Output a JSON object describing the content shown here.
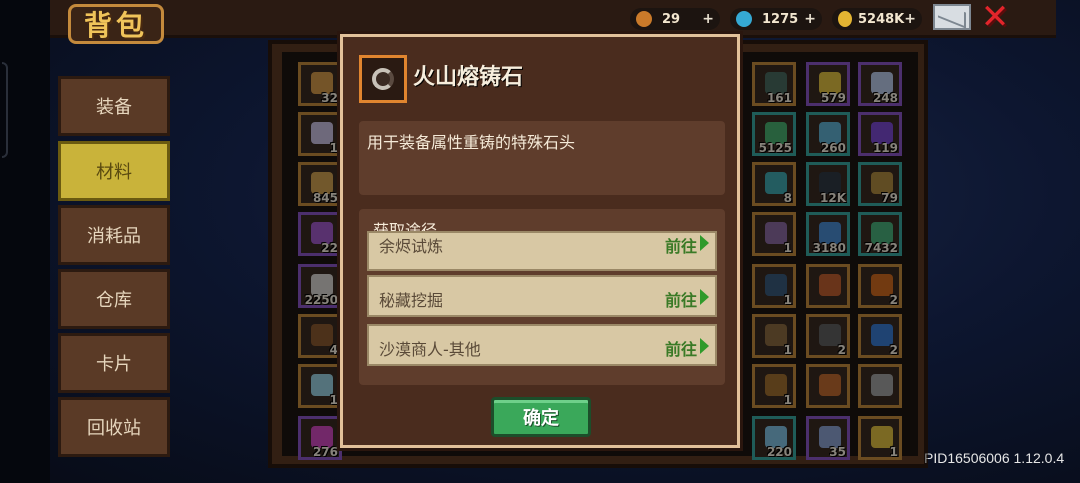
{
  "title": "背包",
  "currencies": [
    {
      "name": "fire-seed",
      "value": "29",
      "plus": "+",
      "color": "#c97a2a"
    },
    {
      "name": "blue-gem",
      "value": "1275",
      "plus": "+",
      "color": "#35a9d4"
    },
    {
      "name": "gold-coin",
      "value": "5248K",
      "plus": "+",
      "color": "#e3b432"
    }
  ],
  "tabs": [
    {
      "label": "装备",
      "active": false
    },
    {
      "label": "材料",
      "active": true
    },
    {
      "label": "消耗品",
      "active": false
    },
    {
      "label": "仓库",
      "active": false
    },
    {
      "label": "卡片",
      "active": false
    },
    {
      "label": "回收站",
      "active": false
    }
  ],
  "inventory_left": [
    {
      "count": "32",
      "border": "#c48a3c",
      "color": "#d49a4a"
    },
    {
      "count": "1",
      "border": "#c48a3c",
      "color": "#c8c0e0"
    },
    {
      "count": "845",
      "border": "#c48a3c",
      "color": "#d0a050"
    },
    {
      "count": "22",
      "border": "#8a56c6",
      "color": "#a05ac8"
    },
    {
      "count": "2250",
      "border": "#8a56c6",
      "color": "#d8d4d0"
    },
    {
      "count": "4",
      "border": "#c48a3c",
      "color": "#8a5a30"
    },
    {
      "count": "1",
      "border": "#c48a3c",
      "color": "#9ad0e0"
    },
    {
      "count": "276",
      "border": "#8a56c6",
      "color": "#d04ac0"
    }
  ],
  "inventory_right": [
    {
      "count": "161",
      "border": "#c48a3c",
      "color": "#4a6a60"
    },
    {
      "count": "579",
      "border": "#8a56c6",
      "color": "#e0c040"
    },
    {
      "count": "248",
      "border": "#8a56c6",
      "color": "#b8c8e8"
    },
    {
      "count": "5125",
      "border": "#3aa8a0",
      "color": "#4ab070"
    },
    {
      "count": "260",
      "border": "#3aa8a0",
      "color": "#60b0d0"
    },
    {
      "count": "119",
      "border": "#8a56c6",
      "color": "#7a4ad0"
    },
    {
      "count": "8",
      "border": "#c48a3c",
      "color": "#40a8b0"
    },
    {
      "count": "12K",
      "border": "#3aa8a0",
      "color": "#303a44"
    },
    {
      "count": "79",
      "border": "#3aa8a0",
      "color": "#b08a40"
    },
    {
      "count": "1",
      "border": "#c48a3c",
      "color": "#8a6aa0"
    },
    {
      "count": "3180",
      "border": "#3aa8a0",
      "color": "#4a8ad0"
    },
    {
      "count": "7432",
      "border": "#3aa8a0",
      "color": "#4ab07a"
    },
    {
      "count": "1",
      "border": "#c48a3c",
      "color": "#3a5a7a"
    },
    {
      "count": "",
      "border": "#c48a3c",
      "color": "#c06030"
    },
    {
      "count": "2",
      "border": "#c48a3c",
      "color": "#d06a20"
    },
    {
      "count": "1",
      "border": "#c48a3c",
      "color": "#8a6a40"
    },
    {
      "count": "2",
      "border": "#c48a3c",
      "color": "#606060"
    },
    {
      "count": "2",
      "border": "#c48a3c",
      "color": "#3a7ad0"
    },
    {
      "count": "1",
      "border": "#c48a3c",
      "color": "#a07030"
    },
    {
      "count": "",
      "border": "#c48a3c",
      "color": "#c06a30"
    },
    {
      "count": "",
      "border": "#c48a3c",
      "color": "#a0a0a0"
    },
    {
      "count": "220",
      "border": "#3aa8a0",
      "color": "#80c0e0"
    },
    {
      "count": "35",
      "border": "#8a56c6",
      "color": "#8aa0d0"
    },
    {
      "count": "1",
      "border": "#c48a3c",
      "color": "#e0c040"
    }
  ],
  "dialog": {
    "item_name": "火山熔铸石",
    "description": "用于装备属性重铸的特殊石头",
    "source_title": "获取途径",
    "routes": [
      {
        "name": "余烬试炼",
        "action": "前往"
      },
      {
        "name": "秘藏挖掘",
        "action": "前往"
      },
      {
        "name": "沙漠商人-其他",
        "action": "前往"
      }
    ],
    "confirm": "确定"
  },
  "version": "PID16506006 1.12.0.4"
}
